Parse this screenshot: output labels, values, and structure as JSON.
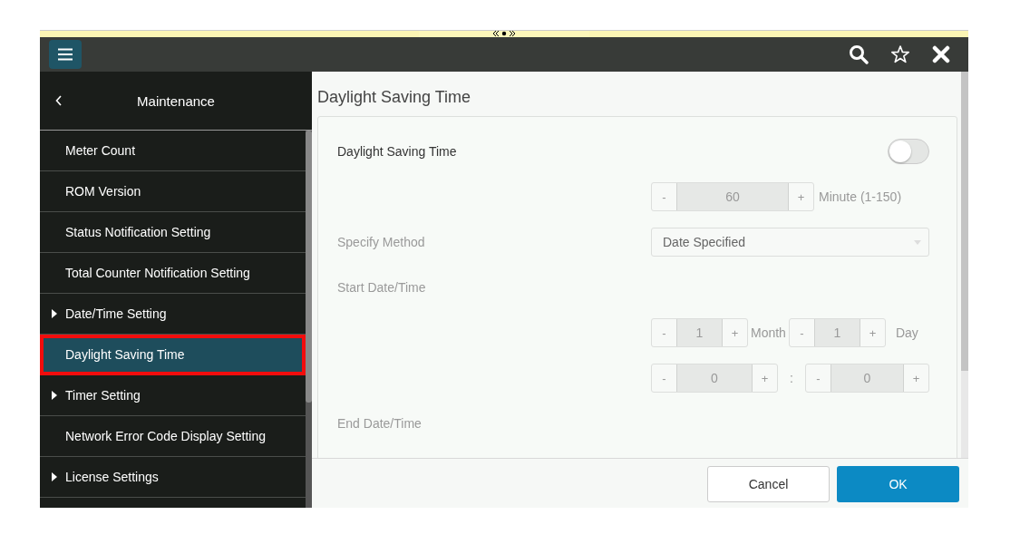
{
  "sidebar": {
    "title": "Maintenance",
    "items": [
      {
        "label": "Meter Count",
        "expandable": false,
        "selected": false,
        "highlighted": false
      },
      {
        "label": "ROM Version",
        "expandable": false,
        "selected": false,
        "highlighted": false
      },
      {
        "label": "Status Notification Setting",
        "expandable": false,
        "selected": false,
        "highlighted": false
      },
      {
        "label": "Total Counter Notification Setting",
        "expandable": false,
        "selected": false,
        "highlighted": false
      },
      {
        "label": "Date/Time Setting",
        "expandable": true,
        "selected": false,
        "highlighted": false
      },
      {
        "label": "Daylight Saving Time",
        "expandable": false,
        "selected": true,
        "highlighted": true
      },
      {
        "label": "Timer Setting",
        "expandable": true,
        "selected": false,
        "highlighted": false
      },
      {
        "label": "Network Error Code Display Setting",
        "expandable": false,
        "selected": false,
        "highlighted": false
      },
      {
        "label": "License Settings",
        "expandable": true,
        "selected": false,
        "highlighted": false
      }
    ]
  },
  "main": {
    "title": "Daylight Saving Time",
    "toggle": {
      "label": "Daylight Saving Time",
      "on": false
    },
    "interval": {
      "minus": "-",
      "value": "60",
      "plus": "+",
      "unit": "Minute (1-150)",
      "disabled": true
    },
    "method": {
      "label": "Specify Method",
      "value": "Date Specified",
      "disabled": true
    },
    "start": {
      "label": "Start Date/Time",
      "disabled": true,
      "month": {
        "minus": "-",
        "value": "1",
        "plus": "+"
      },
      "month_unit": "Month",
      "day": {
        "minus": "-",
        "value": "1",
        "plus": "+"
      },
      "day_unit": "Day",
      "hour": {
        "minus": "-",
        "value": "0",
        "plus": "+"
      },
      "separator": ":",
      "minute": {
        "minus": "-",
        "value": "0",
        "plus": "+"
      }
    },
    "end": {
      "label": "End Date/Time",
      "disabled": true
    }
  },
  "buttons": {
    "cancel": "Cancel",
    "ok": "OK"
  }
}
